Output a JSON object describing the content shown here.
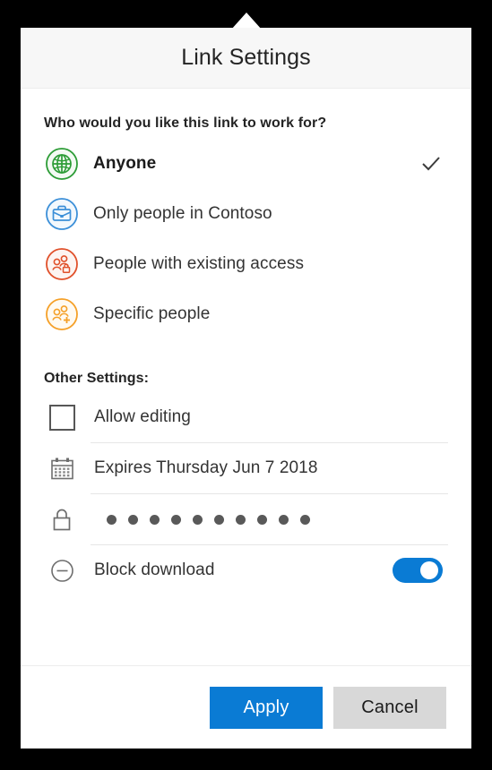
{
  "dialog": {
    "title": "Link Settings",
    "audience_question": "Who would you like this link to work for?",
    "other_settings_label": "Other Settings:",
    "accent_color": "#0a7bd4",
    "options": [
      {
        "label": "Anyone",
        "icon": "globe-icon",
        "color": "#2c9c36",
        "fill": "#f3faf3",
        "selected": true,
        "check": "✓"
      },
      {
        "label": "Only people in Contoso",
        "icon": "briefcase-icon",
        "color": "#3b8fd8",
        "fill": "#f2f8fd",
        "selected": false,
        "check": "✓"
      },
      {
        "label": "People with existing access",
        "icon": "people-lock-icon",
        "color": "#e0502a",
        "fill": "#fdf4f1",
        "selected": false,
        "check": "✓"
      },
      {
        "label": "Specific people",
        "icon": "people-add-icon",
        "color": "#f5a028",
        "fill": "#fffaf1",
        "selected": false,
        "check": "✓"
      }
    ],
    "settings": {
      "allow_editing": {
        "label": "Allow editing",
        "icon": "checkbox-icon",
        "checked": false
      },
      "expiry": {
        "label": "Expires Thursday Jun 7 2018",
        "icon": "calendar-icon"
      },
      "password": {
        "icon": "lock-icon",
        "dots": 10,
        "masked_value": "●●●●●●●●●●"
      },
      "block_download": {
        "label": "Block download",
        "icon": "minus-circle-icon",
        "enabled": true
      }
    },
    "footer": {
      "apply_label": "Apply",
      "cancel_label": "Cancel"
    }
  }
}
